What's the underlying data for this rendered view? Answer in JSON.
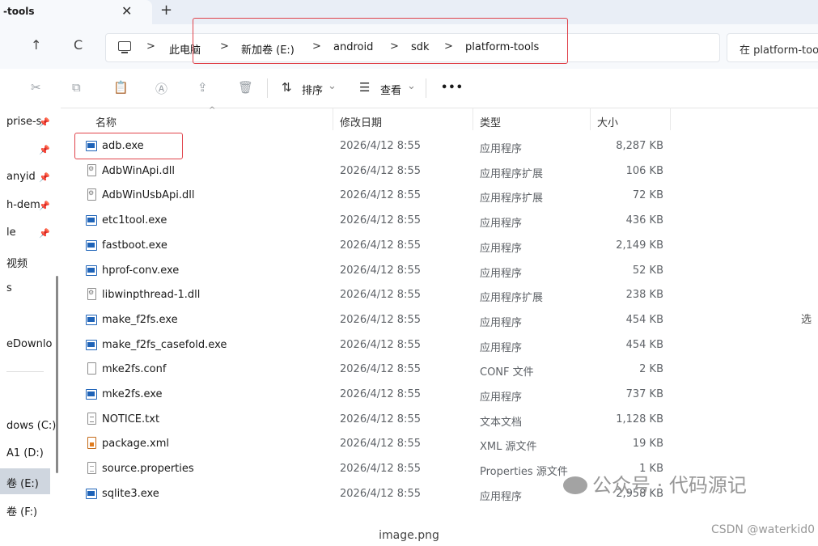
{
  "tab": {
    "title": "-tools",
    "close": "✕",
    "new_tab": "+"
  },
  "nav": {
    "up": "↑",
    "refresh": "C"
  },
  "breadcrumb": [
    "此电脑",
    "新加卷 (E:)",
    "android",
    "sdk",
    "platform-tools"
  ],
  "breadcrumb_sep": ">",
  "search": {
    "placeholder": "在 platform-tools 中搜索"
  },
  "toolbar": {
    "sort_label": "排序",
    "view_label": "查看",
    "more_label": "•••",
    "dropdown": "⌄"
  },
  "sidebar": {
    "items": [
      {
        "label": "prise-s",
        "pinned": true
      },
      {
        "label": "",
        "pinned": true
      },
      {
        "label": "anyid",
        "pinned": true
      },
      {
        "label": "h-dem",
        "pinned": true
      },
      {
        "label": "le",
        "pinned": true
      },
      {
        "label": "视频",
        "pinned": false
      },
      {
        "label": "s",
        "pinned": false
      },
      {
        "label": "eDownlo",
        "pinned": false
      },
      {
        "label": "dows (C:)",
        "pinned": false
      },
      {
        "label": "A1 (D:)",
        "pinned": false
      },
      {
        "label": "卷 (E:)",
        "pinned": false
      },
      {
        "label": "卷 (F:)",
        "pinned": false
      }
    ],
    "pin_glyph": "📌"
  },
  "columns": {
    "name": "名称",
    "date": "修改日期",
    "type": "类型",
    "size": "大小"
  },
  "files": [
    {
      "name": "adb.exe",
      "date": "2026/4/12 8:55",
      "type": "应用程序",
      "size": "8,287 KB",
      "icon": "exe"
    },
    {
      "name": "AdbWinApi.dll",
      "date": "2026/4/12 8:55",
      "type": "应用程序扩展",
      "size": "106 KB",
      "icon": "dll"
    },
    {
      "name": "AdbWinUsbApi.dll",
      "date": "2026/4/12 8:55",
      "type": "应用程序扩展",
      "size": "72 KB",
      "icon": "dll"
    },
    {
      "name": "etc1tool.exe",
      "date": "2026/4/12 8:55",
      "type": "应用程序",
      "size": "436 KB",
      "icon": "exe"
    },
    {
      "name": "fastboot.exe",
      "date": "2026/4/12 8:55",
      "type": "应用程序",
      "size": "2,149 KB",
      "icon": "exe"
    },
    {
      "name": "hprof-conv.exe",
      "date": "2026/4/12 8:55",
      "type": "应用程序",
      "size": "52 KB",
      "icon": "exe"
    },
    {
      "name": "libwinpthread-1.dll",
      "date": "2026/4/12 8:55",
      "type": "应用程序扩展",
      "size": "238 KB",
      "icon": "dll"
    },
    {
      "name": "make_f2fs.exe",
      "date": "2026/4/12 8:55",
      "type": "应用程序",
      "size": "454 KB",
      "icon": "exe"
    },
    {
      "name": "make_f2fs_casefold.exe",
      "date": "2026/4/12 8:55",
      "type": "应用程序",
      "size": "454 KB",
      "icon": "exe"
    },
    {
      "name": "mke2fs.conf",
      "date": "2026/4/12 8:55",
      "type": "CONF 文件",
      "size": "2 KB",
      "icon": "doc"
    },
    {
      "name": "mke2fs.exe",
      "date": "2026/4/12 8:55",
      "type": "应用程序",
      "size": "737 KB",
      "icon": "exe"
    },
    {
      "name": "NOTICE.txt",
      "date": "2026/4/12 8:55",
      "type": "文本文档",
      "size": "1,128 KB",
      "icon": "txt"
    },
    {
      "name": "package.xml",
      "date": "2026/4/12 8:55",
      "type": "XML 源文件",
      "size": "19 KB",
      "icon": "xml"
    },
    {
      "name": "source.properties",
      "date": "2026/4/12 8:55",
      "type": "Properties 源文件",
      "size": "1 KB",
      "icon": "prop"
    },
    {
      "name": "sqlite3.exe",
      "date": "2026/4/12 8:55",
      "type": "应用程序",
      "size": "2,958 KB",
      "icon": "exe"
    }
  ],
  "edge_text": "选",
  "watermark": "公众号 · 代码源记",
  "caption": "image.png",
  "csdn": "CSDN @waterkid0",
  "highlight_color": "#e0434b"
}
